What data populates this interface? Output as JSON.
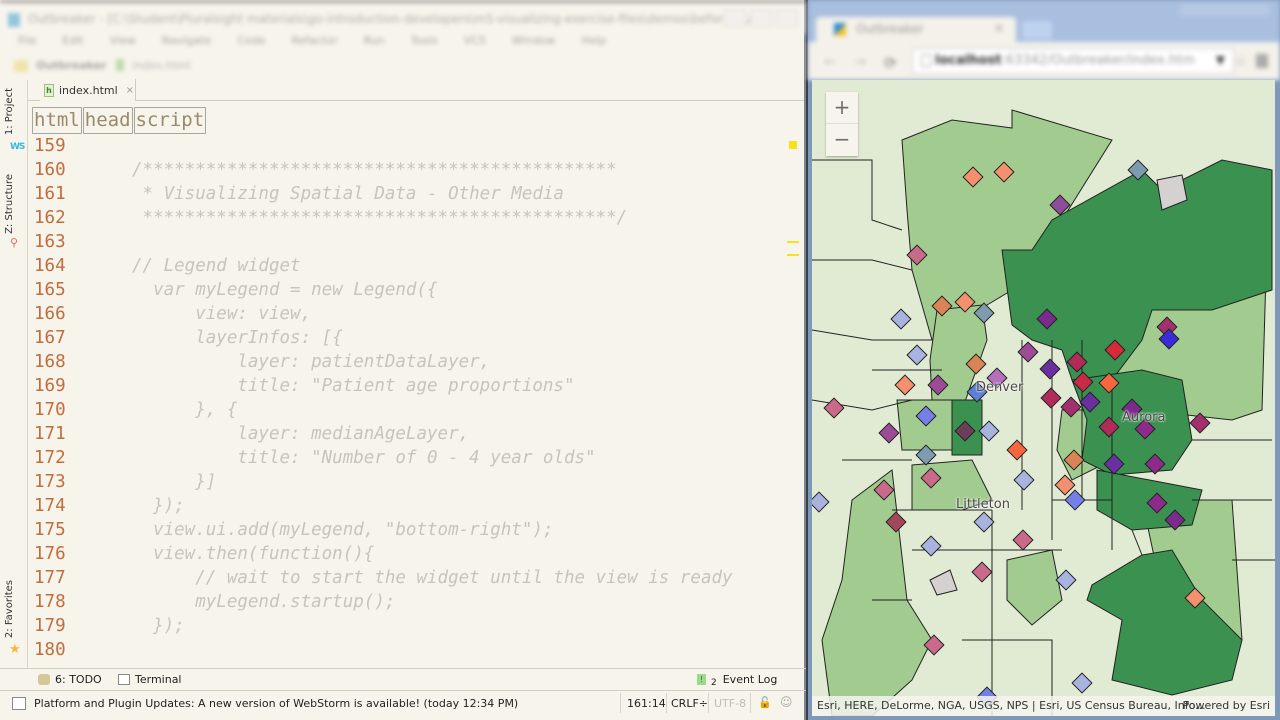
{
  "ide": {
    "title": "Outbreaker - [C:\\Student\\Pluralsight materials\\go-introduction-developers\\m5-visualizing-exercise-files\\demos\\before\\Out...",
    "menu": [
      "File",
      "Edit",
      "View",
      "Navigate",
      "Code",
      "Refactor",
      "Run",
      "Tools",
      "VCS",
      "Window",
      "Help"
    ],
    "nav": {
      "project": "Outbreaker",
      "file": "index.html"
    },
    "side_tabs": {
      "project": "1: Project",
      "structure": "Z: Structure",
      "favorites": "2: Favorites"
    },
    "editor_tab": {
      "filename": "index.html",
      "close": "×"
    },
    "breadcrumbs": [
      "html",
      "head",
      "script"
    ],
    "code_lines": [
      {
        "num": "159",
        "text": ""
      },
      {
        "num": "160",
        "text": "/*********************************************"
      },
      {
        "num": "161",
        "text": " * Visualizing Spatial Data - Other Media"
      },
      {
        "num": "162",
        "text": " *********************************************/"
      },
      {
        "num": "163",
        "text": ""
      },
      {
        "num": "164",
        "text": "// Legend widget"
      },
      {
        "num": "165",
        "text": "  var myLegend = new Legend({"
      },
      {
        "num": "166",
        "text": "      view: view,"
      },
      {
        "num": "167",
        "text": "      layerInfos: [{"
      },
      {
        "num": "168",
        "text": "          layer: patientDataLayer,"
      },
      {
        "num": "169",
        "text": "          title: \"Patient age proportions\""
      },
      {
        "num": "170",
        "text": "      }, {"
      },
      {
        "num": "171",
        "text": "          layer: medianAgeLayer,"
      },
      {
        "num": "172",
        "text": "          title: \"Number of 0 - 4 year olds\""
      },
      {
        "num": "173",
        "text": "      }]"
      },
      {
        "num": "174",
        "text": "  });"
      },
      {
        "num": "175",
        "text": "  view.ui.add(myLegend, \"bottom-right\");"
      },
      {
        "num": "176",
        "text": "  view.then(function(){"
      },
      {
        "num": "177",
        "text": "      // wait to start the widget until the view is ready"
      },
      {
        "num": "178",
        "text": "      myLegend.startup();"
      },
      {
        "num": "179",
        "text": "  });"
      },
      {
        "num": "180",
        "text": ""
      }
    ],
    "bottom_tools": {
      "todo": "6: TODO",
      "terminal": "Terminal",
      "event_log": "Event Log",
      "event_count": "2"
    },
    "status": {
      "message": "Platform and Plugin Updates: A new version of WebStorm is available! (today 12:34 PM)",
      "position": "161:14",
      "line_sep": "CRLF÷",
      "encoding": "UTF-8"
    }
  },
  "browser": {
    "tab_title": "Outbreaker",
    "tab_close": "×",
    "url_host": "localhost",
    "url_path": ":63342/Outbreaker/index.htm",
    "map": {
      "zoom_in": "+",
      "zoom_out": "−",
      "labels": {
        "denver": "Denver",
        "aurora": "Aurora",
        "littleton": "Littleton"
      },
      "attribution": "Esri, HERE, DeLorme, NGA, USGS, NPS | Esri, US Census Bureau, Info...",
      "powered_by": "Powered by Esri",
      "colors": {
        "base": "#e1ead3",
        "light_green": "#a2cc8f",
        "dark_green": "#3a9150",
        "boundary": "#222222"
      }
    }
  }
}
